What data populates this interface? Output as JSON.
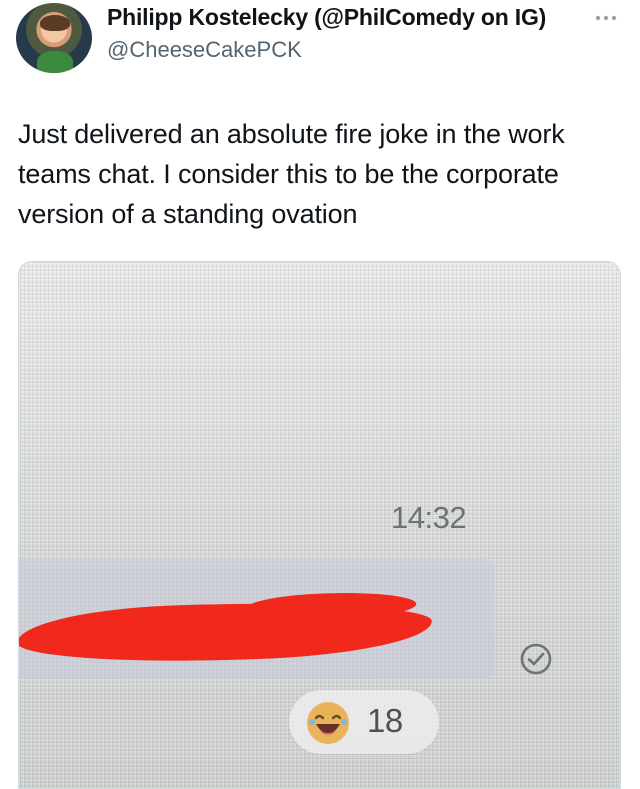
{
  "tweet": {
    "author": {
      "display_name": "Philipp Kostelecky (@PhilComedy on IG)",
      "handle": "@CheeseCakePCK"
    },
    "more_icon": "more-horizontal-icon",
    "text": "Just delivered an absolute fire joke in the work teams chat. I consider this to be the corporate version of a standing ovation"
  },
  "photo": {
    "chat": {
      "timestamp": "14:32",
      "message_redacted": true,
      "redaction_color": "#f0291c",
      "read_receipt_icon": "check-circle-icon",
      "reaction": {
        "emoji_icon": "laughing-emoji-icon",
        "count": "18"
      }
    }
  }
}
